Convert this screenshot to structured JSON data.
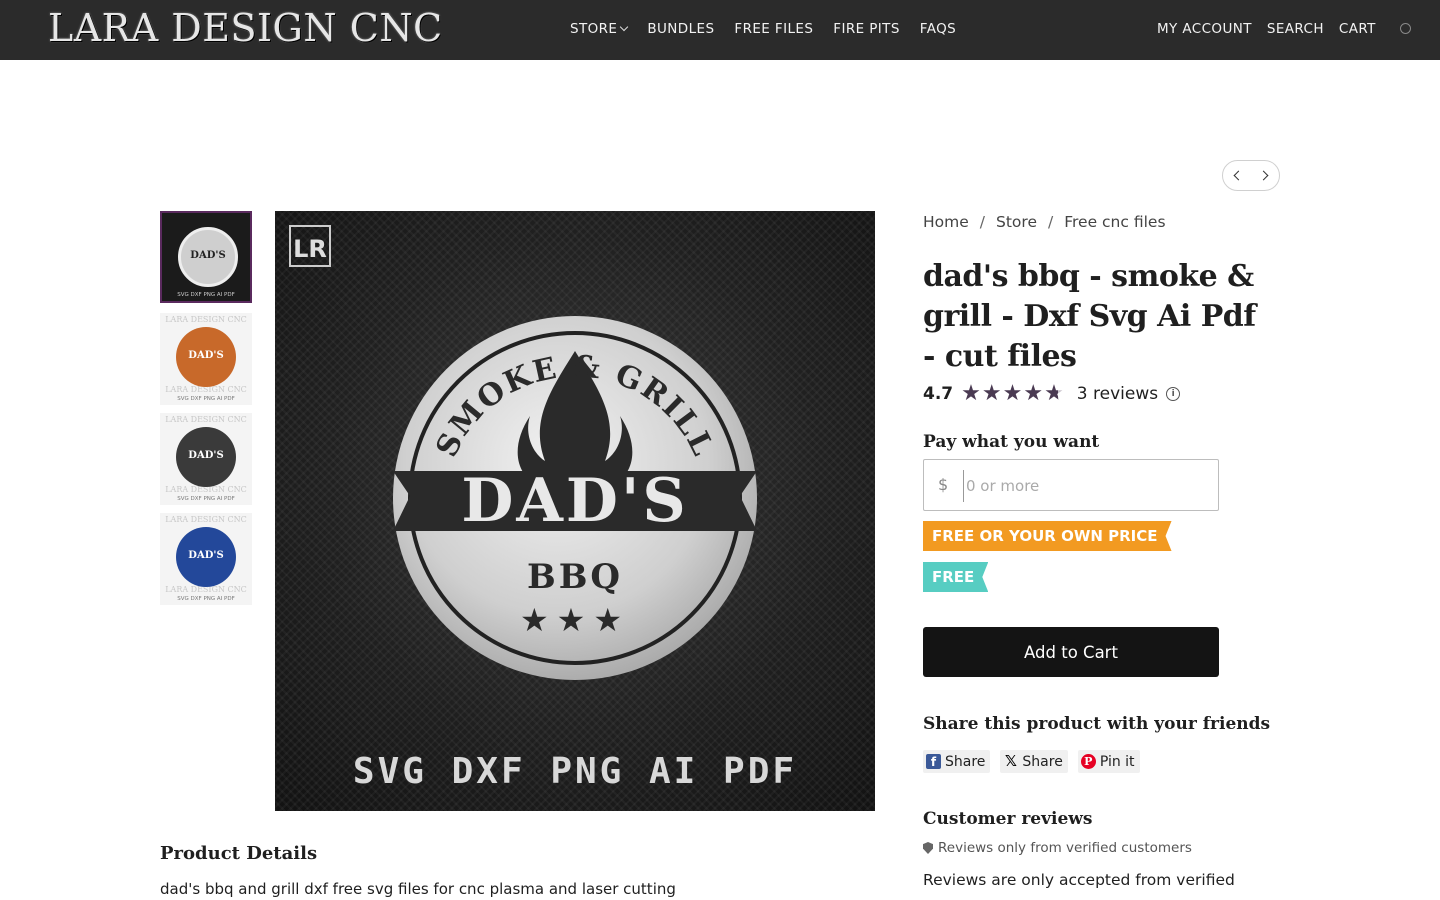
{
  "header": {
    "logo": "LARA DESIGN CNC",
    "nav": [
      "STORE",
      "BUNDLES",
      "FREE FILES",
      "FIRE PITS",
      "FAQS"
    ],
    "right_nav": [
      "MY ACCOUNT",
      "SEARCH",
      "CART"
    ]
  },
  "thumbnails": {
    "watermark": "LARA DESIGN CNC",
    "disc_label": "DAD'S",
    "caption": "SVG DXF PNG AI PDF",
    "colors": [
      "#2a2a2a",
      "#c8692a",
      "#3a3a3a",
      "#23489a"
    ]
  },
  "main_image": {
    "brand_mark": "LR",
    "top_arc": "SMOKE & GRILL",
    "center_text": "DAD'S",
    "sub_text": "BBQ",
    "formats": "SVG DXF PNG AI PDF"
  },
  "breadcrumb": [
    "Home",
    "Store",
    "Free cnc files"
  ],
  "product": {
    "title": "dad's bbq - smoke & grill - Dxf Svg Ai Pdf - cut files",
    "rating": "4.7",
    "stars": 4.7,
    "reviews_label": "3 reviews",
    "info_symbol": "i"
  },
  "pricing": {
    "label": "Pay what you want",
    "currency": "$",
    "placeholder": "0 or more",
    "ribbon_primary": "FREE OR YOUR OWN PRICE",
    "ribbon_secondary": "FREE",
    "ribbon_primary_color": "#f29a21",
    "ribbon_secondary_color": "#57cdc2"
  },
  "cart": {
    "add_label": "Add to Cart"
  },
  "share": {
    "heading": "Share this product with your friends",
    "facebook": "Share",
    "x": "Share",
    "pinterest": "Pin it"
  },
  "reviews": {
    "heading": "Customer reviews",
    "verified_note": "Reviews only from verified customers",
    "note": "Reviews are only accepted from verified"
  },
  "details": {
    "heading": "Product Details",
    "text": "dad's bbq and grill dxf free svg files for cnc plasma and laser cutting"
  }
}
